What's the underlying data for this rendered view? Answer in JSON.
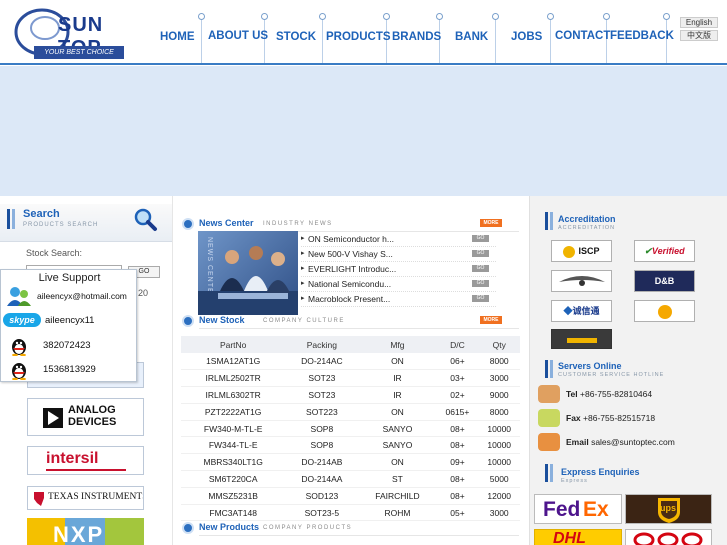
{
  "header": {
    "logo_text": "SUN TOP",
    "logo_tagline": "YOUR BEST CHOICE",
    "nav": [
      "HOME",
      "ABOUT US",
      "STOCK",
      "PRODUCTS",
      "BRANDS",
      "BANK",
      "JOBS",
      "CONTACT",
      "FEEDBACK"
    ],
    "lang_en": "English",
    "lang_cn": "中文版"
  },
  "search": {
    "title": "Search",
    "subtitle": "PRODUCTS SEARCH",
    "label": "Stock Search:",
    "go": "GO",
    "count": "20"
  },
  "live_support": {
    "title": "Live Support",
    "hotmail": "aileencyx@hotmail.com",
    "skype_logo": "skype",
    "skype": "aileencyx11",
    "qq1": "382072423",
    "qq2": "1536813929"
  },
  "brands": {
    "analog_line1": "ANALOG",
    "analog_line2": "DEVICES",
    "intersil": "intersil",
    "ti": "TEXAS INSTRUMENTS",
    "nxp": "NXP"
  },
  "news": {
    "title": "News Center",
    "subtitle": "INDUSTRY NEWS",
    "more": "MORE",
    "vertical": "NEWS CENTER",
    "go": "GO",
    "items": [
      "ON Semiconductor h...",
      "New 500-V Vishay S...",
      "EVERLIGHT Introduc...",
      "National Semicondu...",
      "Macroblock Present..."
    ]
  },
  "stock": {
    "title": "New Stock",
    "subtitle": "COMPANY CULTURE",
    "more": "MORE",
    "columns": [
      "PartNo",
      "Packing",
      "Mfg",
      "D/C",
      "Qty"
    ],
    "rows": [
      [
        "1SMA12AT1G",
        "DO-214AC",
        "ON",
        "06+",
        "8000"
      ],
      [
        "IRLML2502TR",
        "SOT23",
        "IR",
        "03+",
        "3000"
      ],
      [
        "IRLML6302TR",
        "SOT23",
        "IR",
        "02+",
        "9000"
      ],
      [
        "PZT2222AT1G",
        "SOT223",
        "ON",
        "0615+",
        "8000"
      ],
      [
        "FW340-M-TL-E",
        "SOP8",
        "SANYO",
        "08+",
        "10000"
      ],
      [
        "FW344-TL-E",
        "SOP8",
        "SANYO",
        "08+",
        "10000"
      ],
      [
        "MBRS340LT1G",
        "DO-214AB",
        "ON",
        "09+",
        "10000"
      ],
      [
        "SM6T220CA",
        "DO-214AA",
        "ST",
        "08+",
        "5000"
      ],
      [
        "MMSZ5231B",
        "SOD123",
        "FAIRCHILD",
        "08+",
        "12000"
      ],
      [
        "FMC3AT148",
        "SOT23-5",
        "ROHM",
        "05+",
        "3000"
      ]
    ]
  },
  "new_products": {
    "title": "New Products",
    "subtitle": "COMPANY PRODUCTS"
  },
  "accreditation": {
    "title": "Accreditation",
    "subtitle": "ACCREDITATION",
    "badges": [
      "ISCP",
      "Verified",
      "",
      "D&B",
      "诚信通",
      "",
      "",
      ""
    ]
  },
  "servers": {
    "title": "Servers Online",
    "subtitle": "CUSTOMER SERVICE HOTLINE",
    "tel_label": "Tel",
    "tel": "+86-755-82810464",
    "fax_label": "Fax",
    "fax": "+86-755-82515718",
    "email_label": "Email",
    "email": "sales@suntoptec.com"
  },
  "express": {
    "title": "Express Enquiries",
    "subtitle": "Express",
    "fedex_a": "Fed",
    "fedex_b": "Ex",
    "ups": "ups",
    "dhl": "DHL"
  },
  "colors": {
    "nav_blue": "#1e62b8",
    "banner": "#dce8f7",
    "accent_orange": "#f07020"
  }
}
